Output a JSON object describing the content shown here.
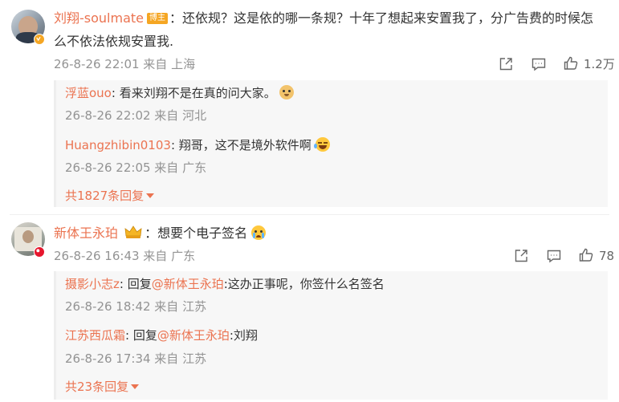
{
  "comments": [
    {
      "user": "刘翔-soulmate",
      "badge": "博主",
      "text_line1": "：还依规？这是依的哪一条规？十年了想起来安置我了，分广告费的时候怎",
      "text_line2": "么不依法依规安置我.",
      "time": "26-8-26 22:01 来自 上海",
      "likes": "1.2万",
      "replies": [
        {
          "user": "浮蓝ouo",
          "text": ": 看来刘翔不是在真的问大家。",
          "meta": "26-8-26 22:02 来自 河北",
          "emoji": "doge-icon"
        },
        {
          "user": "Huangzhibin0103",
          "text": ": 翔哥，这不是境外软件啊",
          "meta": "26-8-26 22:05 来自 广东",
          "emoji": "laugh-cry-icon"
        }
      ],
      "more": "共1827条回复"
    },
    {
      "user": "新体王永珀",
      "text": "：想要个电子签名",
      "time": "26-8-26 16:43 来自 广东",
      "likes": "78",
      "replies": [
        {
          "user": "摄影小志z",
          "text_prefix": ": 回复",
          "mention": "@新体王永珀",
          "text": ":这办正事呢，你签什么名签名",
          "meta": "26-8-26 18:42 来自 江苏"
        },
        {
          "user": "江苏西瓜霜",
          "text_prefix": ": 回复",
          "mention": "@新体王永珀",
          "text": ":刘翔",
          "meta": "26-8-26 17:34 来自 江苏"
        }
      ],
      "more": "共23条回复"
    }
  ],
  "colors": {
    "accent": "#eb7350",
    "meta": "#939393",
    "badge": "#f5a623",
    "vip": "#f5a623",
    "red_badge": "#e6162d"
  }
}
